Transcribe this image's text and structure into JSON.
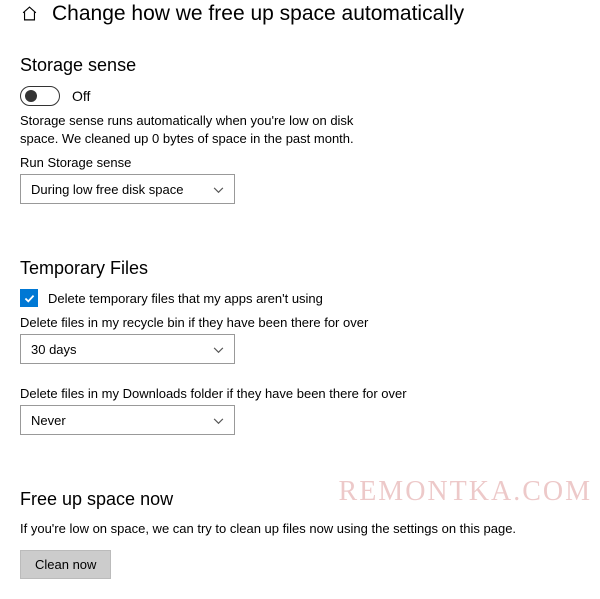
{
  "header": {
    "title": "Change how we free up space automatically"
  },
  "storage_sense": {
    "heading": "Storage sense",
    "toggle_state": "Off",
    "description": "Storage sense runs automatically when you're low on disk space. We cleaned up 0 bytes of space in the past month.",
    "run_label": "Run Storage sense",
    "run_value": "During low free disk space"
  },
  "temp_files": {
    "heading": "Temporary Files",
    "checkbox_label": "Delete temporary files that my apps aren't using",
    "checkbox_checked": true,
    "recycle_label": "Delete files in my recycle bin if they have been there for over",
    "recycle_value": "30 days",
    "downloads_label": "Delete files in my Downloads folder if they have been there for over",
    "downloads_value": "Never"
  },
  "free_up": {
    "heading": "Free up space now",
    "description": "If you're low on space, we can try to clean up files now using the settings on this page.",
    "button_label": "Clean now"
  },
  "watermark": "REMONTKA.COM"
}
